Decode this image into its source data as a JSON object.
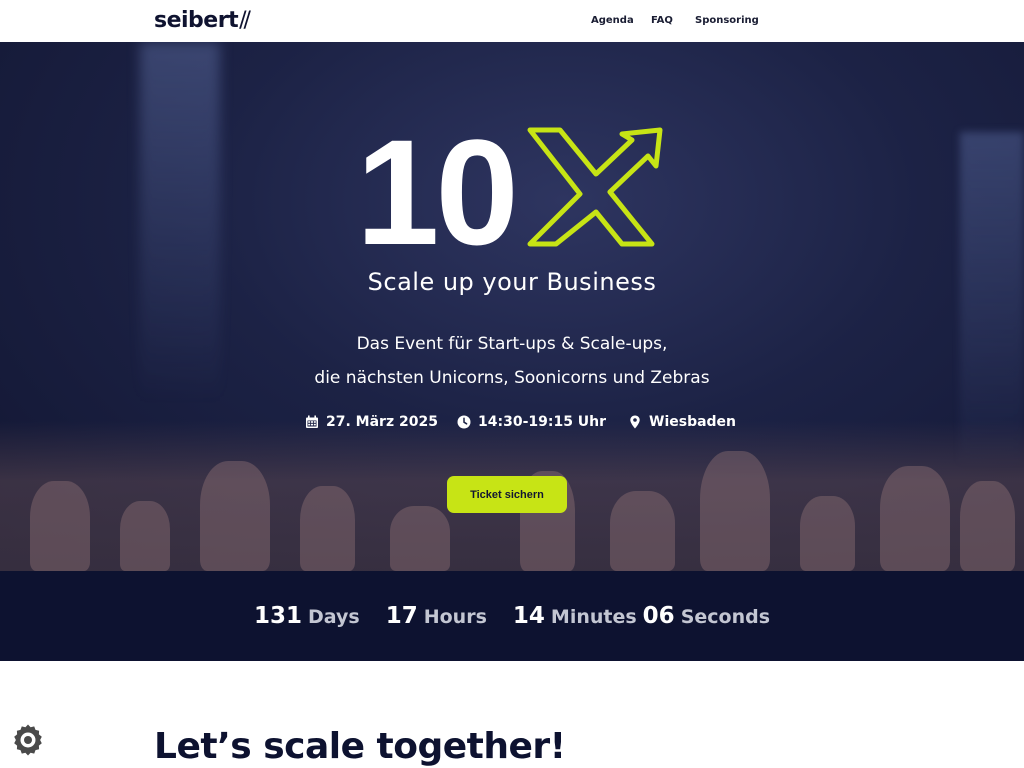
{
  "header": {
    "logo_text": "seibert",
    "logo_slashes": "//",
    "nav": [
      {
        "label": "Agenda"
      },
      {
        "label": "FAQ"
      },
      {
        "label": "Sponsoring"
      }
    ]
  },
  "hero": {
    "logo_number": "10",
    "logo_icon": "x-arrow-logo",
    "tagline": "Scale up your Business",
    "description_line1": "Das Event für Start-ups & Scale-ups,",
    "description_line2": "die nächsten Unicorns, Soonicorns und Zebras",
    "date": {
      "icon": "calendar-icon",
      "text": "27. März 2025"
    },
    "time": {
      "icon": "clock-icon",
      "text": "14:30-19:15 Uhr"
    },
    "location": {
      "icon": "map-pin-icon",
      "text": "Wiesbaden"
    },
    "cta_label": "Ticket sichern"
  },
  "countdown": {
    "days": "131",
    "days_label": "Days",
    "hours": "17",
    "hours_label": "Hours",
    "minutes": "14",
    "minutes_label": "Minutes",
    "seconds": "06",
    "seconds_label": "Seconds"
  },
  "section": {
    "heading": "Let’s scale together!"
  },
  "cookie": {
    "icon": "cookie-settings-icon"
  },
  "colors": {
    "accent": "#c7e415",
    "navy": "#0d1230",
    "white": "#ffffff"
  }
}
